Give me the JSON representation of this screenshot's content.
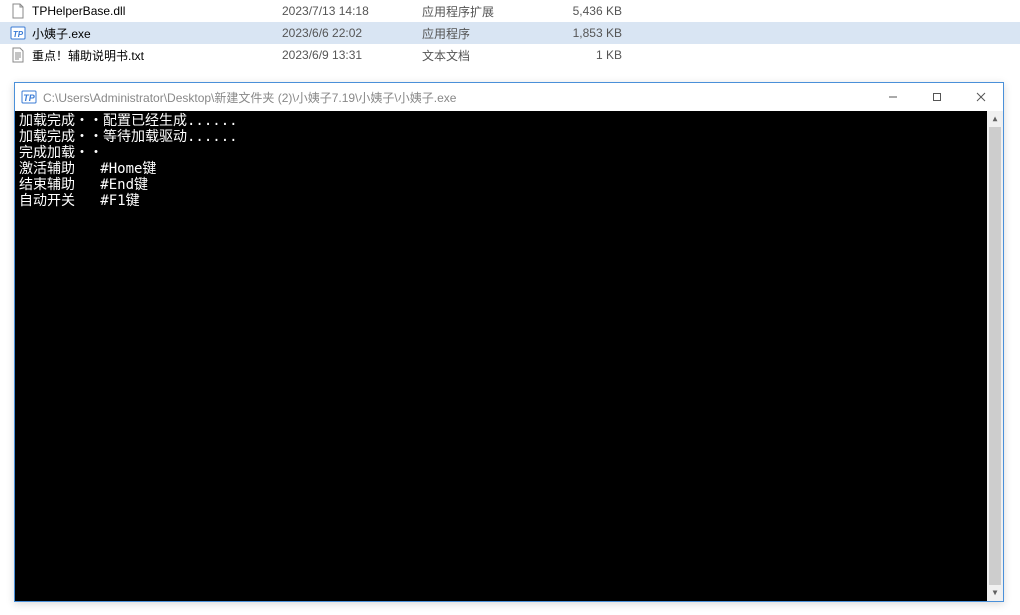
{
  "files": [
    {
      "name": "TPHelperBase.dll",
      "date": "2023/7/13 14:18",
      "type": "应用程序扩展",
      "size": "5,436 KB",
      "icon": "dll",
      "selected": false
    },
    {
      "name": "小姨子.exe",
      "date": "2023/6/6 22:02",
      "type": "应用程序",
      "size": "1,853 KB",
      "icon": "exe",
      "selected": true
    },
    {
      "name": "重点！辅助说明书.txt",
      "date": "2023/6/9 13:31",
      "type": "文本文档",
      "size": "1 KB",
      "icon": "txt",
      "selected": false
    }
  ],
  "console": {
    "title": "C:\\Users\\Administrator\\Desktop\\新建文件夹 (2)\\小姨子7.19\\小姨子\\小姨子.exe",
    "lines": [
      "加载完成・・配置已经生成......",
      "加载完成・・等待加载驱动......",
      "完成加载・・",
      "激活辅助   #Home键",
      "结束辅助   #End键",
      "自动开关   #F1键"
    ]
  }
}
